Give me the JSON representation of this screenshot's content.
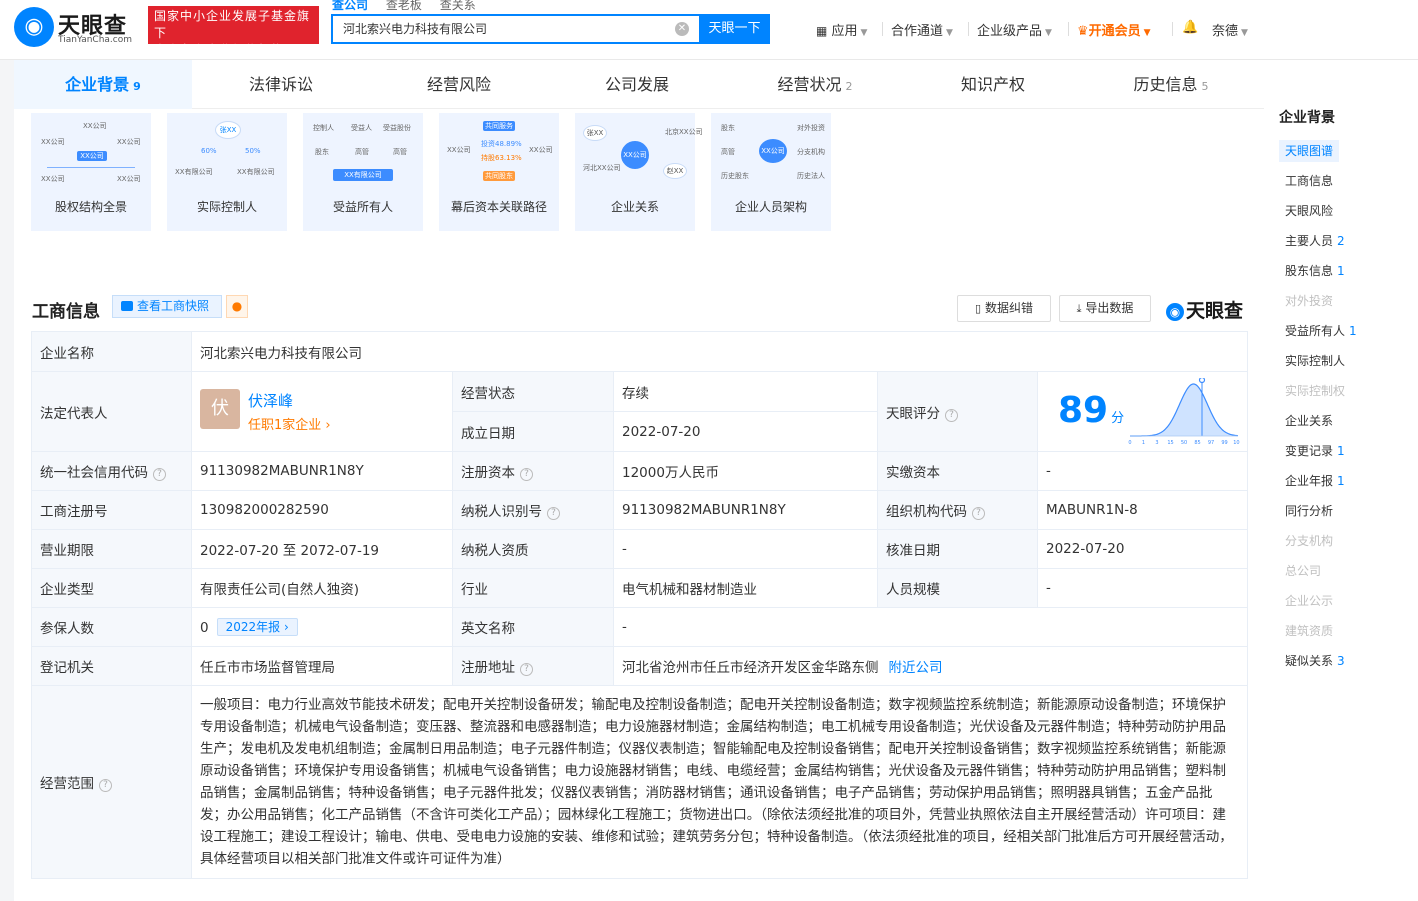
{
  "header": {
    "logo_text": "天眼查",
    "logo_sub": "TianYanCha.com",
    "slogan_line1": "国家中小企业发展子基金旗下",
    "slogan_line2": "官方备案企业征信机构",
    "search_tabs": [
      "查公司",
      "查老板",
      "查关系"
    ],
    "search_value": "河北索兴电力科技有限公司",
    "search_button": "天眼一下",
    "nav": [
      "应用",
      "合作通道",
      "企业级产品",
      "开通会员"
    ],
    "user": "奈德"
  },
  "tabs": [
    {
      "label": "企业背景",
      "count": "9"
    },
    {
      "label": "法律诉讼",
      "count": ""
    },
    {
      "label": "经营风险",
      "count": ""
    },
    {
      "label": "公司发展",
      "count": ""
    },
    {
      "label": "经营状况",
      "count": "2"
    },
    {
      "label": "知识产权",
      "count": ""
    },
    {
      "label": "历史信息",
      "count": "5"
    }
  ],
  "cards": [
    "股权结构全景",
    "实际控制人",
    "受益所有人",
    "幕后资本关联路径",
    "企业关系",
    "企业人员架构"
  ],
  "diagram_labels": {
    "xx_company": "XX公司",
    "xx_limited": "XX有限公司",
    "zhang": "张XX",
    "zhao": "赵XX",
    "pct_a": "60%",
    "pct_b": "50%",
    "controller": "控制人",
    "beneficiary": "受益人",
    "benefit_share": "受益股份",
    "shareholder": "股东",
    "exec": "高管",
    "common_service": "共同服务",
    "invest_path_a": "投资48.89%",
    "invest_path_b": "持股63.13%",
    "common_shareholder": "共同股东",
    "beijing_co": "北京XX公司",
    "hebei_co": "河北XX公司",
    "outward_invest": "对外投资",
    "branch": "分支机构",
    "hist_shareholder": "历史股东",
    "hist_legal": "历史法人"
  },
  "section": {
    "title": "工商信息",
    "snapshot": "查看工商快照",
    "correct_btn": "数据纠错",
    "export_btn": "导出数据",
    "brand": "天眼查"
  },
  "info": {
    "company_name_label": "企业名称",
    "company_name": "河北索兴电力科技有限公司",
    "legal_rep_label": "法定代表人",
    "legal_rep_avatar": "伏",
    "legal_rep": "伏泽峰",
    "legal_rep_jobs": "任职1家企业",
    "status_label": "经营状态",
    "status": "存续",
    "found_date_label": "成立日期",
    "found_date": "2022-07-20",
    "score_label": "天眼评分",
    "score": "89",
    "score_unit": "分",
    "score_ticks": [
      "0",
      "1",
      "3",
      "15",
      "50",
      "85",
      "97",
      "99",
      "100"
    ],
    "credit_code_label": "统一社会信用代码",
    "credit_code": "91130982MABUNR1N8Y",
    "reg_capital_label": "注册资本",
    "reg_capital": "12000万人民币",
    "paid_capital_label": "实缴资本",
    "paid_capital": "-",
    "reg_no_label": "工商注册号",
    "reg_no": "130982000282590",
    "taxpayer_id_label": "纳税人识别号",
    "taxpayer_id": "91130982MABUNR1N8Y",
    "org_code_label": "组织机构代码",
    "org_code": "MABUNR1N-8",
    "term_label": "营业期限",
    "term": "2022-07-20 至 2072-07-19",
    "taxpayer_qual_label": "纳税人资质",
    "taxpayer_qual": "-",
    "approve_date_label": "核准日期",
    "approve_date": "2022-07-20",
    "type_label": "企业类型",
    "type": "有限责任公司(自然人独资)",
    "industry_label": "行业",
    "industry": "电气机械和器材制造业",
    "staff_label": "人员规模",
    "staff": "-",
    "insured_label": "参保人数",
    "insured": "0",
    "insured_year": "2022年报",
    "english_label": "英文名称",
    "english": "-",
    "authority_label": "登记机关",
    "authority": "任丘市市场监督管理局",
    "address_label": "注册地址",
    "address": "河北省沧州市任丘市经济开发区金华路东侧",
    "nearby": "附近公司",
    "scope_label": "经营范围",
    "scope": "一般项目：电力行业高效节能技术研发；配电开关控制设备研发；输配电及控制设备制造；配电开关控制设备制造；数字视频监控系统制造；新能源原动设备制造；环境保护专用设备制造；机械电气设备制造；变压器、整流器和电感器制造；电力设施器材制造；金属结构制造；电工机械专用设备制造；光伏设备及元器件制造；特种劳动防护用品生产；发电机及发电机组制造；金属制日用品制造；电子元器件制造；仪器仪表制造；智能输配电及控制设备销售；配电开关控制设备销售；数字视频监控系统销售；新能源原动设备销售；环境保护专用设备销售；机械电气设备销售；电力设施器材销售；电线、电缆经营；金属结构销售；光伏设备及元器件销售；特种劳动防护用品销售；塑料制品销售；金属制品销售；特种设备销售；电子元器件批发；仪器仪表销售；消防器材销售；通讯设备销售；电子产品销售；劳动保护用品销售；照明器具销售；五金产品批发；办公用品销售；化工产品销售（不含许可类化工产品）；园林绿化工程施工；货物进出口。（除依法须经批准的项目外，凭营业执照依法自主开展经营活动）许可项目：建设工程施工；建设工程设计；输电、供电、受电电力设施的安装、维修和试验；建筑劳务分包；特种设备制造。（依法须经批准的项目，经相关部门批准后方可开展经营活动，具体经营项目以相关部门批准文件或许可证件为准）"
  },
  "sidebar": {
    "title": "企业背景",
    "items": [
      {
        "label": "天眼图谱",
        "count": "",
        "state": "active"
      },
      {
        "label": "工商信息",
        "count": "",
        "state": "normal"
      },
      {
        "label": "天眼风险",
        "count": "",
        "state": "normal"
      },
      {
        "label": "主要人员",
        "count": "2",
        "state": "normal"
      },
      {
        "label": "股东信息",
        "count": "1",
        "state": "normal"
      },
      {
        "label": "对外投资",
        "count": "",
        "state": "disabled"
      },
      {
        "label": "受益所有人",
        "count": "1",
        "state": "normal"
      },
      {
        "label": "实际控制人",
        "count": "",
        "state": "normal"
      },
      {
        "label": "实际控制权",
        "count": "",
        "state": "disabled"
      },
      {
        "label": "企业关系",
        "count": "",
        "state": "normal"
      },
      {
        "label": "变更记录",
        "count": "1",
        "state": "normal"
      },
      {
        "label": "企业年报",
        "count": "1",
        "state": "normal"
      },
      {
        "label": "同行分析",
        "count": "",
        "state": "normal"
      },
      {
        "label": "分支机构",
        "count": "",
        "state": "disabled"
      },
      {
        "label": "总公司",
        "count": "",
        "state": "disabled"
      },
      {
        "label": "企业公示",
        "count": "",
        "state": "disabled"
      },
      {
        "label": "建筑资质",
        "count": "",
        "state": "disabled"
      },
      {
        "label": "疑似关系",
        "count": "3",
        "state": "normal"
      }
    ]
  },
  "colors": {
    "accent": "#0084ff",
    "status_green": "#19a05a",
    "vip_orange": "#ff6a00",
    "slogan_red": "#e0232d"
  }
}
